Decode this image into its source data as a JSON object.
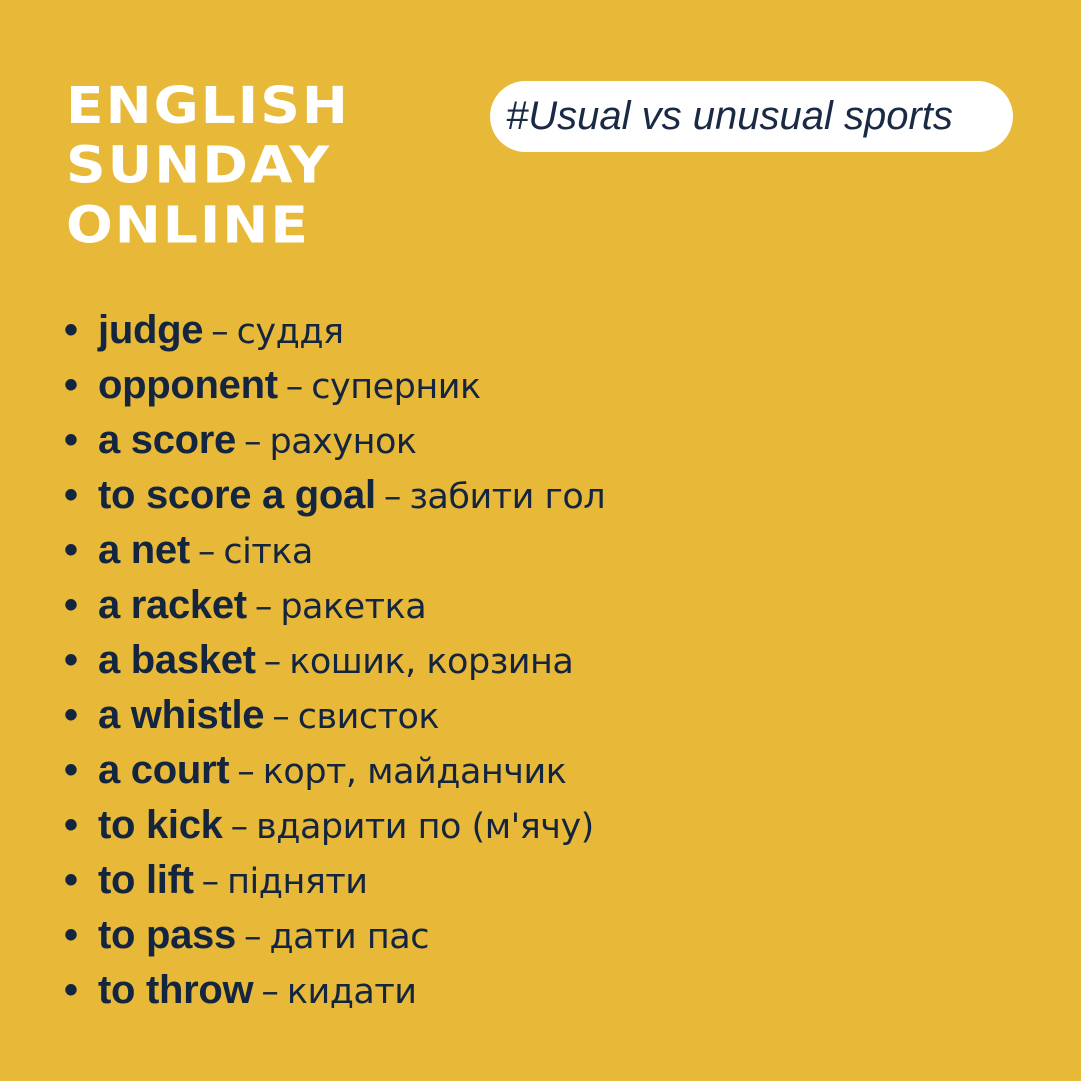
{
  "header": {
    "title_lines": [
      "English",
      "Sunday",
      "Online"
    ],
    "tag": "#Usual vs unusual sports"
  },
  "vocabulary": [
    {
      "term": "judge",
      "translation": "суддя"
    },
    {
      "term": "opponent",
      "translation": "суперник"
    },
    {
      "term": "a score",
      "translation": "рахунок"
    },
    {
      "term": "to score a goal",
      "translation": "забити гол"
    },
    {
      "term": "a net",
      "translation": "сітка"
    },
    {
      "term": "a racket",
      "translation": "ракетка"
    },
    {
      "term": "a basket",
      "translation": "кошик, корзина"
    },
    {
      "term": "a whistle",
      "translation": "свисток"
    },
    {
      "term": "a court",
      "translation": "корт, майданчик"
    },
    {
      "term": "to kick",
      "translation": "вдарити по (м'ячу)"
    },
    {
      "term": "to lift",
      "translation": "підняти"
    },
    {
      "term": "to pass",
      "translation": "дати пас"
    },
    {
      "term": "to throw",
      "translation": "кидати"
    }
  ],
  "bullet_symbol": "•",
  "separator": "–",
  "colors": {
    "background": "#e8b838",
    "title": "#ffffff",
    "text": "#14253f",
    "tag_background": "#ffffff"
  }
}
